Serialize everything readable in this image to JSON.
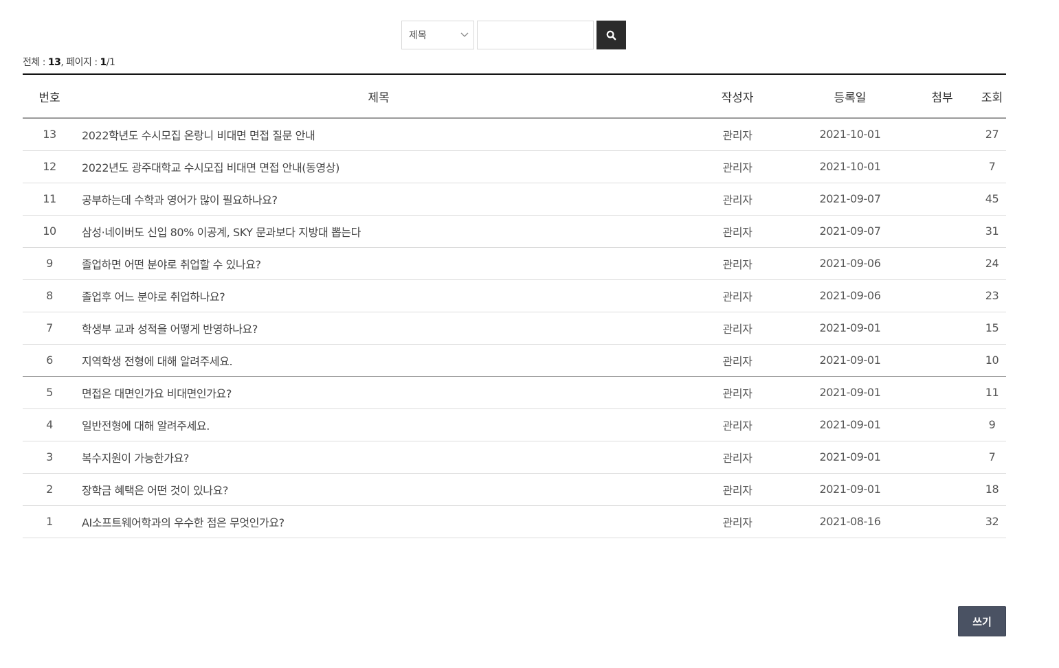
{
  "search": {
    "field_selected": "제목",
    "query_value": "",
    "placeholder": ""
  },
  "summary": {
    "total_label": "전체 : ",
    "total_count": "13",
    "page_label": ", 페이지 : ",
    "current_page": "1",
    "page_sep_total": "/1"
  },
  "table": {
    "headers": {
      "num": "번호",
      "title": "제목",
      "author": "작성자",
      "date": "등록일",
      "attach": "첨부",
      "views": "조회"
    },
    "rows": [
      {
        "num": "13",
        "title": "2022학년도 수시모집 온랑니 비대면 면접 질문 안내",
        "author": "관리자",
        "date": "2021-10-01",
        "attach": "",
        "views": "27"
      },
      {
        "num": "12",
        "title": "2022년도 광주대학교 수시모집 비대면 면접 안내(동영상)",
        "author": "관리자",
        "date": "2021-10-01",
        "attach": "",
        "views": "7"
      },
      {
        "num": "11",
        "title": "공부하는데 수학과 영어가 많이 필요하나요?",
        "author": "관리자",
        "date": "2021-09-07",
        "attach": "",
        "views": "45"
      },
      {
        "num": "10",
        "title": "삼성·네이버도 신입 80% 이공계, SKY 문과보다 지방대 뽑는다",
        "author": "관리자",
        "date": "2021-09-07",
        "attach": "",
        "views": "31"
      },
      {
        "num": "9",
        "title": "졸업하면 어떤 분야로 취업할 수 있나요?",
        "author": "관리자",
        "date": "2021-09-06",
        "attach": "",
        "views": "24"
      },
      {
        "num": "8",
        "title": "졸업후 어느 분야로 취업하나요?",
        "author": "관리자",
        "date": "2021-09-06",
        "attach": "",
        "views": "23"
      },
      {
        "num": "7",
        "title": "학생부 교과 성적을 어떻게 반영하나요?",
        "author": "관리자",
        "date": "2021-09-01",
        "attach": "",
        "views": "15"
      },
      {
        "num": "6",
        "title": "지역학생 전형에 대해 알려주세요.",
        "author": "관리자",
        "date": "2021-09-01",
        "attach": "",
        "views": "10"
      },
      {
        "num": "5",
        "title": "면접은 대면인가요 비대면인가요?",
        "author": "관리자",
        "date": "2021-09-01",
        "attach": "",
        "views": "11"
      },
      {
        "num": "4",
        "title": "일반전형에 대해 알려주세요.",
        "author": "관리자",
        "date": "2021-09-01",
        "attach": "",
        "views": "9"
      },
      {
        "num": "3",
        "title": "복수지원이 가능한가요?",
        "author": "관리자",
        "date": "2021-09-01",
        "attach": "",
        "views": "7"
      },
      {
        "num": "2",
        "title": "장학금 혜택은 어떤 것이 있나요?",
        "author": "관리자",
        "date": "2021-09-01",
        "attach": "",
        "views": "18"
      },
      {
        "num": "1",
        "title": "AI소프트웨어학과의 우수한 점은 무엇인가요?",
        "author": "관리자",
        "date": "2021-08-16",
        "attach": "",
        "views": "32"
      }
    ]
  },
  "actions": {
    "write_label": "쓰기"
  },
  "icons": {
    "search": "search-icon",
    "dropdown": "chevron-down-icon"
  },
  "colors": {
    "search_button_bg": "#2b2b2b",
    "write_button_bg": "#4a5263",
    "header_top_border": "#111111"
  }
}
